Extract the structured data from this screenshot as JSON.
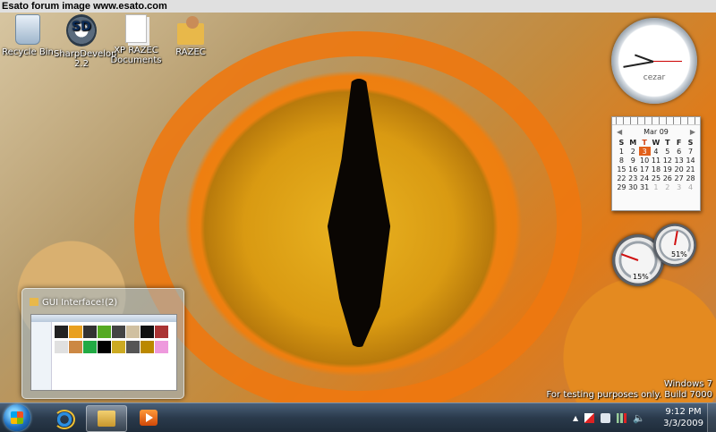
{
  "banner": {
    "text": "Esato forum image www.esato.com"
  },
  "desktop_icons": [
    {
      "label": "Recycle Bin",
      "icon": "recycle-bin-icon"
    },
    {
      "label": "SharpDevelop 2.2",
      "icon": "sharpdevelop-icon"
    },
    {
      "label": "XP RAZEC Documents",
      "icon": "document-shortcut-icon"
    },
    {
      "label": "RAZEC",
      "icon": "user-folder-icon"
    }
  ],
  "clock_gadget": {
    "label": "cezar"
  },
  "calendar_gadget": {
    "month": "Mar 09",
    "prev": "◀",
    "next": "▶",
    "weekdays": [
      "S",
      "M",
      "T",
      "W",
      "T",
      "F",
      "S"
    ],
    "weeks": [
      [
        "1",
        "2",
        "3",
        "4",
        "5",
        "6",
        "7"
      ],
      [
        "8",
        "9",
        "10",
        "11",
        "12",
        "13",
        "14"
      ],
      [
        "15",
        "16",
        "17",
        "18",
        "19",
        "20",
        "21"
      ],
      [
        "22",
        "23",
        "24",
        "25",
        "26",
        "27",
        "28"
      ],
      [
        "29",
        "30",
        "31",
        "1",
        "2",
        "3",
        "4"
      ]
    ],
    "today": "3",
    "accent": "#e2601a"
  },
  "meter_gadget": {
    "cpu": "15%",
    "memory": "51%"
  },
  "taskbar_preview": {
    "title": "GUI Interface!(2)"
  },
  "watermark": {
    "line1": "Windows 7",
    "line2": "For testing purposes only. Build 7000"
  },
  "taskbar": {
    "buttons": [
      {
        "name": "internet-explorer",
        "icon": "ie-icon"
      },
      {
        "name": "windows-explorer",
        "icon": "folder-icon",
        "active": true
      },
      {
        "name": "windows-media-player",
        "icon": "media-player-icon"
      }
    ],
    "time": "9:12 PM",
    "date": "3/3/2009",
    "tray_expand": "▲"
  }
}
